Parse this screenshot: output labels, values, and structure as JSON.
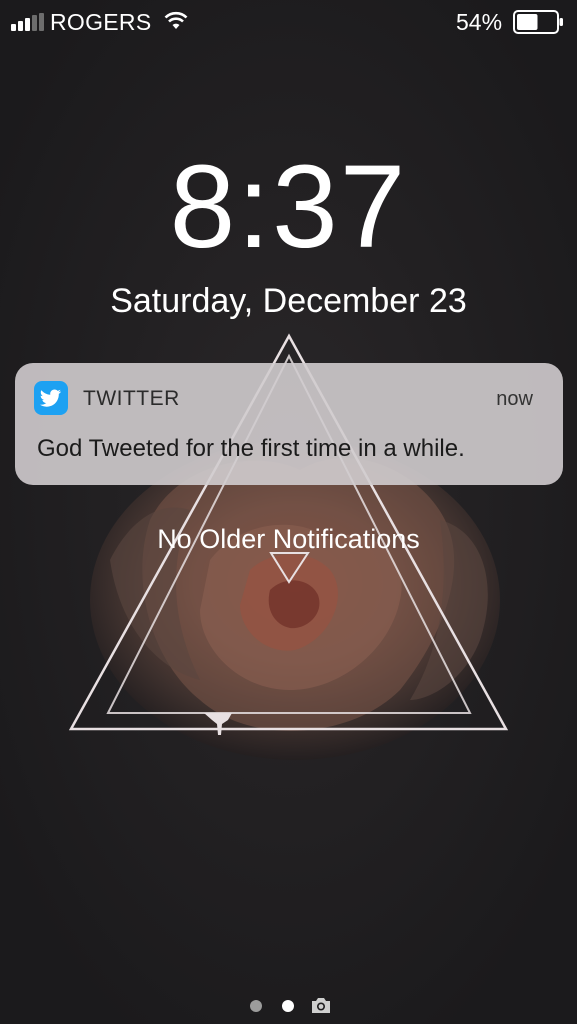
{
  "status_bar": {
    "carrier": "ROGERS",
    "battery_percent": "54%",
    "battery_level": 0.54,
    "signal_bars": 3,
    "signal_max": 5
  },
  "lock_screen": {
    "time": "8:37",
    "date": "Saturday, December 23"
  },
  "notification": {
    "app_name": "TWITTER",
    "time": "now",
    "message": "God Tweeted for the first time in a while.",
    "icon": "twitter-bird-icon",
    "icon_color": "#1da1f2"
  },
  "no_older_label": "No Older Notifications",
  "page_indicator": {
    "pages": 2,
    "current": 2,
    "camera_icon": "camera-icon"
  },
  "colors": {
    "background": "#1d1c1e",
    "notification_bg": "#d0ccce",
    "twitter_blue": "#1da1f2"
  }
}
